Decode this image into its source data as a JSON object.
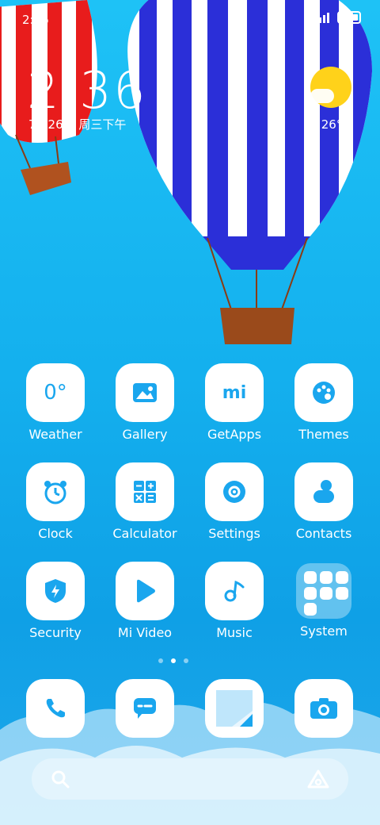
{
  "status": {
    "time": "2:36"
  },
  "lock": {
    "clock": "2:36",
    "date": "7月26日 周三下午",
    "weather": "晴 26°C"
  },
  "apps": [
    {
      "label": "Weather",
      "icon": "weather-icon",
      "glyph": "0°"
    },
    {
      "label": "Gallery",
      "icon": "gallery-icon"
    },
    {
      "label": "GetApps",
      "icon": "getapps-icon",
      "glyph": "mi"
    },
    {
      "label": "Themes",
      "icon": "themes-icon"
    },
    {
      "label": "Clock",
      "icon": "clock-icon"
    },
    {
      "label": "Calculator",
      "icon": "calculator-icon"
    },
    {
      "label": "Settings",
      "icon": "settings-icon"
    },
    {
      "label": "Contacts",
      "icon": "contacts-icon"
    },
    {
      "label": "Security",
      "icon": "security-icon"
    },
    {
      "label": "Mi Video",
      "icon": "mivideo-icon"
    },
    {
      "label": "Music",
      "icon": "music-icon"
    },
    {
      "label": "System",
      "icon": "folder-icon"
    }
  ],
  "dock": [
    {
      "icon": "phone-icon"
    },
    {
      "icon": "messages-icon"
    },
    {
      "icon": "notes-icon"
    },
    {
      "icon": "camera-icon"
    }
  ],
  "colors": {
    "accent": "#1aa6ee",
    "balloon_blue": "#2b2fd8",
    "balloon_red": "#e81c1c",
    "sun": "#ffd21a"
  }
}
